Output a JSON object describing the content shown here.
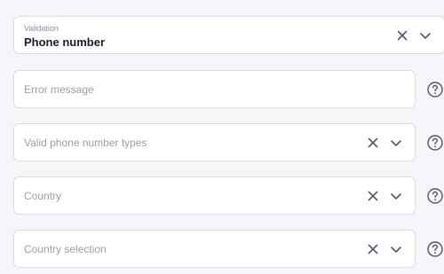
{
  "validation": {
    "label": "Validation",
    "value": "Phone number"
  },
  "fields": [
    {
      "placeholder": "Error message",
      "has_clear": false,
      "has_dropdown": false
    },
    {
      "placeholder": "Valid phone number types",
      "has_clear": true,
      "has_dropdown": true
    },
    {
      "placeholder": "Country",
      "has_clear": true,
      "has_dropdown": true
    },
    {
      "placeholder": "Country selection",
      "has_clear": true,
      "has_dropdown": true
    }
  ],
  "icons": {
    "clear": "close-icon",
    "dropdown": "chevron-down-icon",
    "help": "help-circle-icon"
  },
  "colors": {
    "background": "#f5f5fa",
    "border": "#dcdce6",
    "icon": "#55556a",
    "placeholder": "#9c9cab"
  }
}
